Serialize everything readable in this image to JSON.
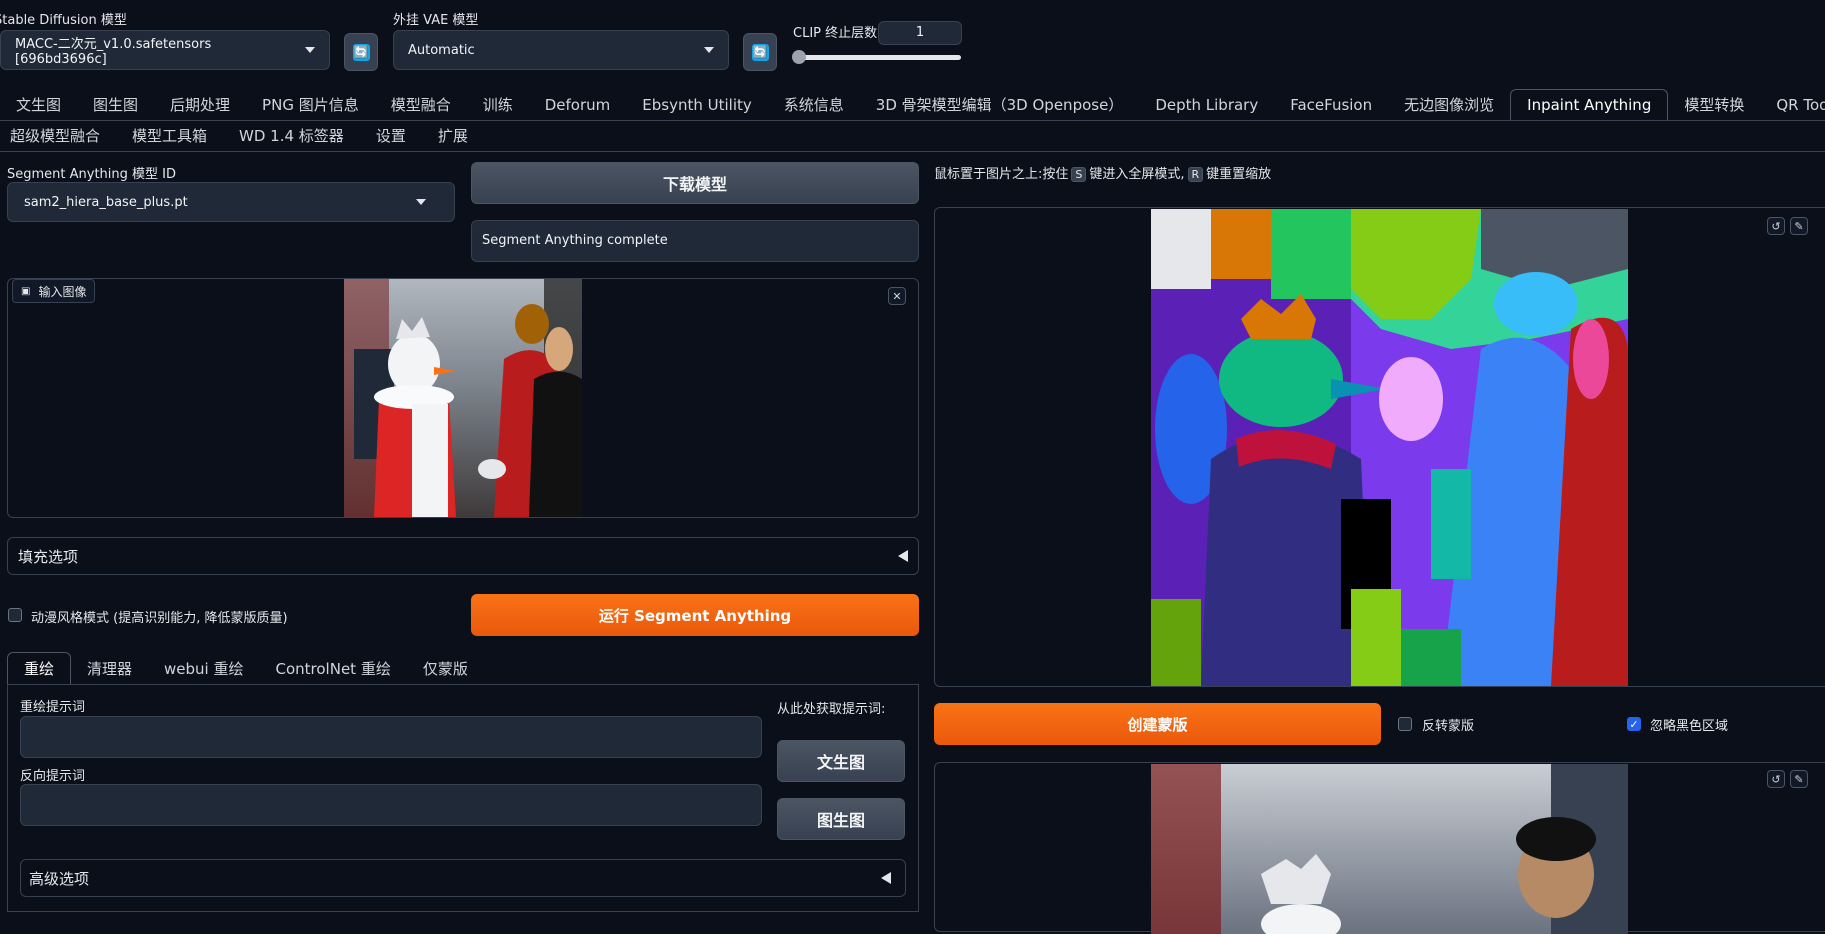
{
  "top": {
    "sd_model_label": "Stable Diffusion 模型",
    "sd_model_value": "MACC-二次元_v1.0.safetensors [696bd3696c]",
    "vae_label": "外挂 VAE 模型",
    "vae_value": "Automatic",
    "clip_label": "CLIP 终止层数",
    "clip_value": "1",
    "refresh_icon": "🔄"
  },
  "tabs_row1": [
    "文生图",
    "图生图",
    "后期处理",
    "PNG 图片信息",
    "模型融合",
    "训练",
    "Deforum",
    "Ebsynth Utility",
    "系统信息",
    "3D 骨架模型编辑（3D Openpose）",
    "Depth Library",
    "FaceFusion",
    "无边图像浏览",
    "Inpaint Anything",
    "模型转换",
    "QR Toolkit"
  ],
  "tabs_row2": [
    "超级模型融合",
    "模型工具箱",
    "WD 1.4 标签器",
    "设置",
    "扩展"
  ],
  "active_tab": "Inpaint Anything",
  "left": {
    "sam_label": "Segment Anything 模型 ID",
    "sam_value": "sam2_hiera_base_plus.pt",
    "download_button": "下载模型",
    "status_text": "Segment Anything complete",
    "input_image_label": "输入图像",
    "input_image_icon": "image-icon",
    "close_icon": "✕",
    "fill_options": "填充选项",
    "anime_checkbox": "动漫风格模式 (提高识别能力, 降低蒙版质量)",
    "run_button": "运行 Segment Anything",
    "subtabs": [
      "重绘",
      "清理器",
      "webui 重绘",
      "ControlNet 重绘",
      "仅蒙版"
    ],
    "inpaint_prompt_label": "重绘提示词",
    "negative_prompt_label": "反向提示词",
    "get_prompt_label": "从此处获取提示词:",
    "txt2img_button": "文生图",
    "img2img_button": "图生图",
    "advanced_options": "高级选项"
  },
  "right": {
    "hint_prefix": "鼠标置于图片之上:按住",
    "hint_key_s": "S",
    "hint_mid": "键进入全屏模式,",
    "hint_key_r": "R",
    "hint_suffix": "键重置缩放",
    "create_mask_button": "创建蒙版",
    "invert_mask_label": "反转蒙版",
    "ignore_black_label": "忽略黑色区域",
    "ignore_black_checked": true,
    "undo_icon": "↺",
    "brush_icon": "✎",
    "check_icon": "✓"
  },
  "colors": {
    "accent_orange": "#f97316",
    "bg": "#0b0f19",
    "panel_border": "#374151",
    "checkbox_blue": "#2563eb"
  }
}
